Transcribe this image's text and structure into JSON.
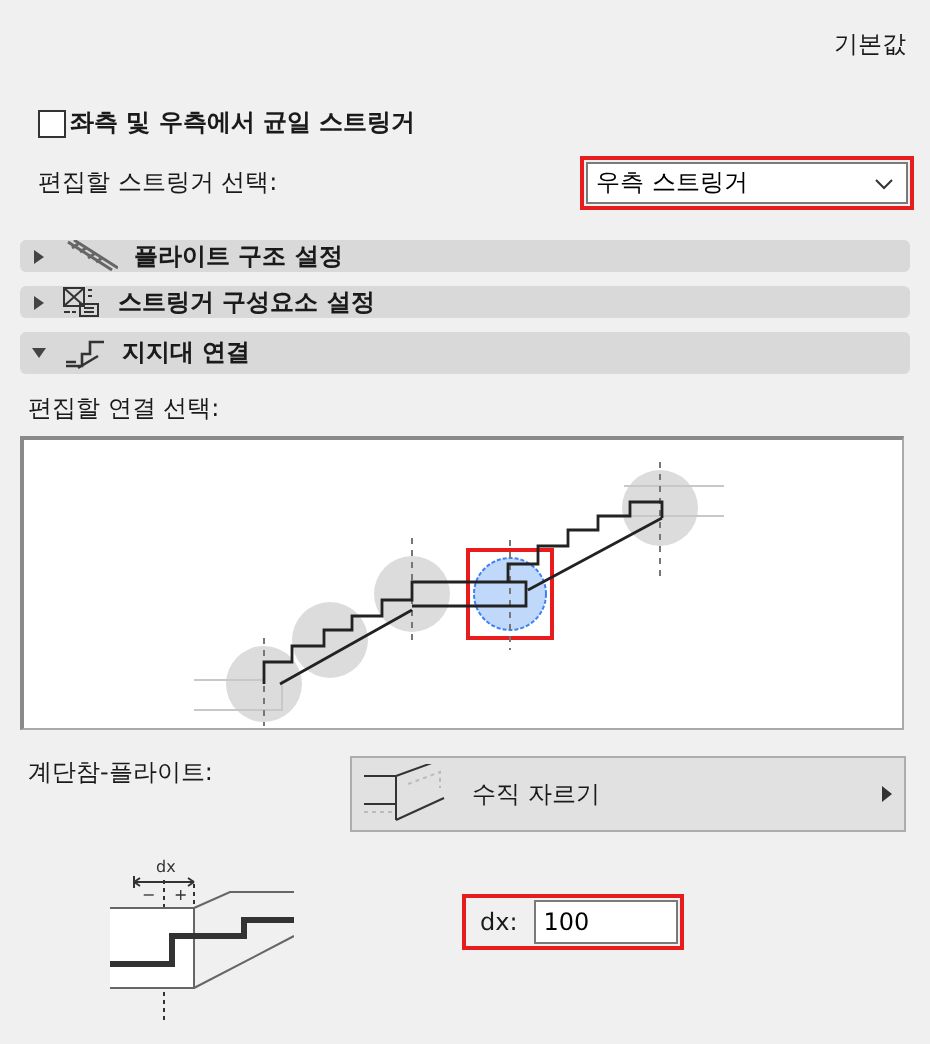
{
  "defaults_label": "기본값",
  "uniform_stringer": {
    "label": "좌측 및 우측에서 균일 스트링거",
    "checked": false
  },
  "stringer_select": {
    "label": "편집할 스트링거 선택:",
    "value": "우측 스트링거",
    "highlighted": true
  },
  "sections": [
    {
      "title": "플라이트 구조 설정",
      "expanded": false,
      "kind": "flight"
    },
    {
      "title": "스트링거 구성요소 설정",
      "expanded": false,
      "kind": "components"
    },
    {
      "title": "지지대 연결",
      "expanded": true,
      "kind": "support"
    }
  ],
  "connection_select": {
    "label": "편집할 연결 선택:"
  },
  "connections": [
    {
      "selected": false
    },
    {
      "selected": false
    },
    {
      "selected": false
    },
    {
      "selected": true
    },
    {
      "selected": false
    }
  ],
  "landing_flight": {
    "label": "계단참-플라이트:",
    "value": "수직 자르기"
  },
  "dx_drawing": {
    "label": "dx",
    "minus": "−",
    "plus": "+"
  },
  "dx_field": {
    "label": "dx:",
    "value": "100",
    "highlighted": true
  }
}
